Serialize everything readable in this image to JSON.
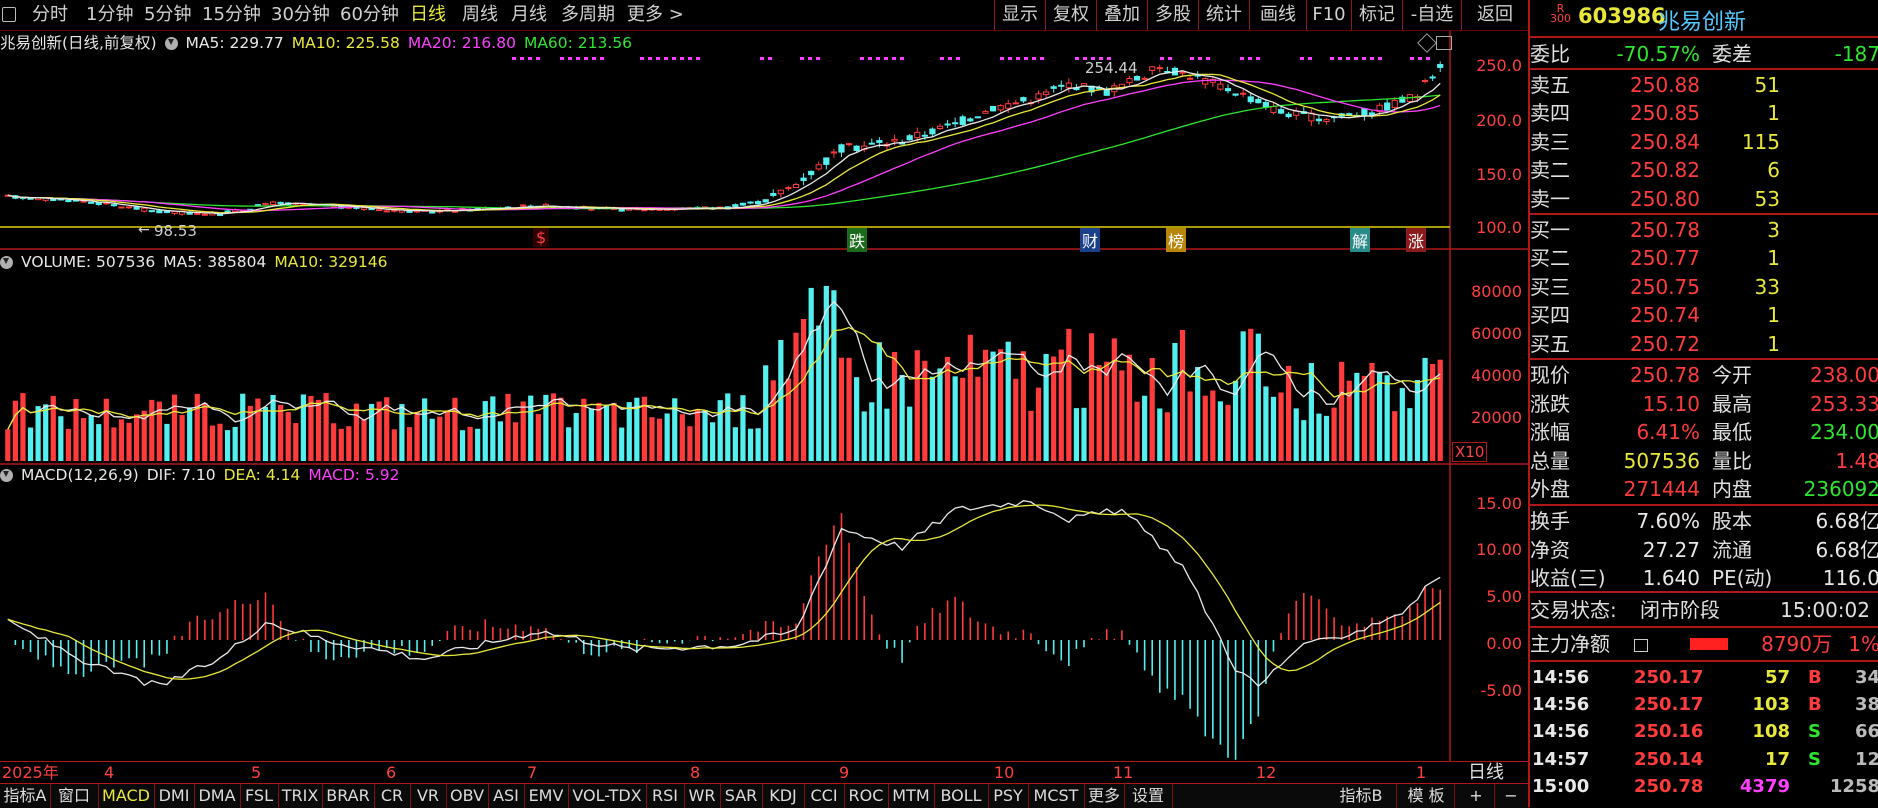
{
  "toolbar": {
    "periods": [
      "分时",
      "1分钟",
      "5分钟",
      "15分钟",
      "30分钟",
      "60分钟",
      "日线",
      "周线",
      "月线",
      "多周期",
      "更多 >"
    ],
    "active_period": "日线",
    "tools": [
      "显示",
      "复权",
      "叠加",
      "多股",
      "统计",
      "画线",
      "F10",
      "标记",
      "-自选",
      "返回"
    ]
  },
  "price_panel": {
    "title": "兆易创新(日线,前复权)",
    "ma5": "MA5: 229.77",
    "ma10": "MA10: 225.58",
    "ma20": "MA20: 216.80",
    "ma60": "MA60: 213.56",
    "y_ticks": [
      "250.0",
      "200.0",
      "150.0",
      "100.0"
    ],
    "high_label": "254.44",
    "low_label": "98.53",
    "events": [
      "$",
      "跌",
      "财",
      "榜",
      "解",
      "涨"
    ]
  },
  "volume_panel": {
    "volume": "VOLUME: 507536",
    "ma5": "MA5: 385804",
    "ma10": "MA10: 329146",
    "y_ticks": [
      "80000",
      "60000",
      "40000",
      "20000"
    ],
    "unit": "X10"
  },
  "macd_panel": {
    "title": "MACD(12,26,9)",
    "dif": "DIF: 7.10",
    "dea": "DEA: 4.14",
    "macd": "MACD: 5.92",
    "y_ticks": [
      "15.00",
      "10.00",
      "5.00",
      "0.00",
      "-5.00"
    ]
  },
  "months": [
    "2025年",
    "4",
    "5",
    "6",
    "7",
    "8",
    "9",
    "10",
    "11",
    "12",
    "1"
  ],
  "period_label": "日线",
  "bottom_tabs": [
    "指标A",
    "窗口",
    "MACD",
    "DMI",
    "DMA",
    "FSL",
    "TRIX",
    "BRAR",
    "CR",
    "VR",
    "OBV",
    "ASI",
    "EMV",
    "VOL-TDX",
    "RSI",
    "WR",
    "SAR",
    "KDJ",
    "CCI",
    "ROC",
    "MTM",
    "BOLL",
    "PSY",
    "MCST",
    "更多",
    "设置"
  ],
  "active_tab": "MACD",
  "bottom_right": [
    "指标B",
    "模 板",
    "+",
    "−"
  ],
  "quote": {
    "badge_top": "R",
    "badge_bottom": "300",
    "code": "603986",
    "name": "兆易创新",
    "weibi_label": "委比",
    "weibi": "-70.57%",
    "weicha_label": "委差",
    "weicha": "-187",
    "asks": [
      {
        "label": "卖五",
        "price": "250.88",
        "vol": "51"
      },
      {
        "label": "卖四",
        "price": "250.85",
        "vol": "1"
      },
      {
        "label": "卖三",
        "price": "250.84",
        "vol": "115"
      },
      {
        "label": "卖二",
        "price": "250.82",
        "vol": "6"
      },
      {
        "label": "卖一",
        "price": "250.80",
        "vol": "53"
      }
    ],
    "bids": [
      {
        "label": "买一",
        "price": "250.78",
        "vol": "3"
      },
      {
        "label": "买二",
        "price": "250.77",
        "vol": "1"
      },
      {
        "label": "买三",
        "price": "250.75",
        "vol": "33"
      },
      {
        "label": "买四",
        "price": "250.74",
        "vol": "1"
      },
      {
        "label": "买五",
        "price": "250.72",
        "vol": "1"
      }
    ],
    "stats": [
      {
        "l1": "现价",
        "v1": "250.78",
        "l2": "今开",
        "v2": "238.00"
      },
      {
        "l1": "涨跌",
        "v1": "15.10",
        "l2": "最高",
        "v2": "253.33"
      },
      {
        "l1": "涨幅",
        "v1": "6.41%",
        "l2": "最低",
        "v2": "234.00"
      },
      {
        "l1": "总量",
        "v1": "507536",
        "l2": "量比",
        "v2": "1.48"
      },
      {
        "l1": "外盘",
        "v1": "271444",
        "l2": "内盘",
        "v2": "236092"
      }
    ],
    "stats2": [
      {
        "l1": "换手",
        "v1": "7.60%",
        "l2": "股本",
        "v2": "6.68亿"
      },
      {
        "l1": "净资",
        "v1": "27.27",
        "l2": "流通",
        "v2": "6.68亿"
      },
      {
        "l1": "收益(三)",
        "v1": "1.640",
        "l2": "PE(动)",
        "v2": "116.0"
      }
    ],
    "status_label": "交易状态:",
    "status": "闭市阶段",
    "status_time": "15:00:02",
    "flow_label": "主力净额",
    "flow_value": "8790万",
    "flow_pct": "1%",
    "ticks": [
      {
        "time": "14:56",
        "price": "250.17",
        "vol": "57",
        "side": "B",
        "n": "34"
      },
      {
        "time": "14:56",
        "price": "250.17",
        "vol": "103",
        "side": "B",
        "n": "38"
      },
      {
        "time": "14:56",
        "price": "250.16",
        "vol": "108",
        "side": "S",
        "n": "66"
      },
      {
        "time": "14:57",
        "price": "250.14",
        "vol": "17",
        "side": "S",
        "n": "12"
      },
      {
        "time": "15:00",
        "price": "250.78",
        "vol": "4379",
        "side": "",
        "n": "1258"
      }
    ]
  },
  "colors": {
    "up": "#ff3b3b",
    "down": "#54f0f0",
    "ma5": "#e8e8e8",
    "ma10": "#e8e83a",
    "ma20": "#ff40ff",
    "ma60": "#2ee62e",
    "frame": "#b01818"
  }
}
